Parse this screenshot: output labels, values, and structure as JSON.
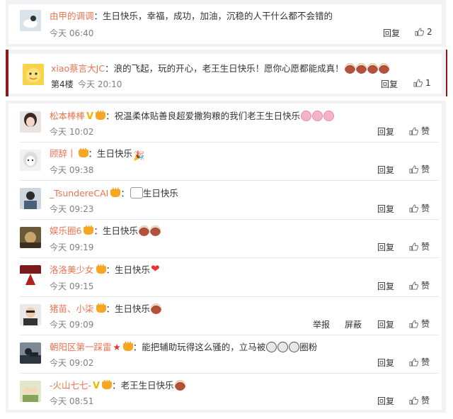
{
  "comments": [
    {
      "user": "由甲的调调",
      "sep": "：",
      "text": "生日快乐，幸福，成功，加油，沉稳的人干什么都不会错的",
      "time": "今天 06:40",
      "reply": "回复",
      "like": "2"
    },
    {
      "user": "xiao蔡言大JC",
      "sep": "：",
      "text": "浪的飞起，玩的开心，老王生日快乐！愿你心愿都能成真！",
      "floor": "第4楼",
      "time": "今天 20:10",
      "reply": "回复",
      "like": "1"
    },
    {
      "user": "松本棒棒",
      "sep": "：",
      "text": "祝温柔体贴善良超爱撒狗粮的我们老王生日快乐",
      "time": "今天 10:02",
      "reply": "回复",
      "like": "赞"
    },
    {
      "user": "顾辞丨",
      "sep": "：",
      "text": "生日快乐",
      "time": "今天 09:38",
      "reply": "回复",
      "like": "赞"
    },
    {
      "user": "_TsundereCAI",
      "sep": "：",
      "text": "生日快乐",
      "time": "今天 09:23",
      "reply": "回复",
      "like": "赞"
    },
    {
      "user": "娱乐圈6",
      "sep": "：",
      "text": "生日快乐",
      "time": "今天 09:19",
      "reply": "回复",
      "like": "赞"
    },
    {
      "user": "洛洛美少女",
      "sep": "：",
      "text": "生日快乐",
      "time": "今天 09:15",
      "reply": "回复",
      "like": "赞"
    },
    {
      "user": "猪苗、小柒",
      "sep": "：",
      "text": "生日快乐",
      "time": "今天 09:09",
      "report": "举报",
      "block": "屏蔽",
      "reply": "回复",
      "like": "赞"
    },
    {
      "user": "朝阳区第一踩雷",
      "sep": "：",
      "text": "能把辅助玩得这么骚的，立马被",
      "text2": "圈粉",
      "time": "今天 09:02",
      "reply": "回复",
      "like": "赞"
    },
    {
      "user": "-火山七七-",
      "sep": "：",
      "text": "老王生日快乐",
      "time": "今天 08:51",
      "reply": "回复",
      "like": "赞"
    }
  ],
  "icons": {
    "like": "thumbs-up-icon",
    "verified": "verified-v-icon",
    "crown": "vip-crown-icon",
    "star": "star-icon"
  },
  "colors": {
    "username": "#eb7350",
    "text": "#333333",
    "time": "#808080",
    "accent_bar": "#8c1a1a",
    "verified": "#f0b500"
  }
}
